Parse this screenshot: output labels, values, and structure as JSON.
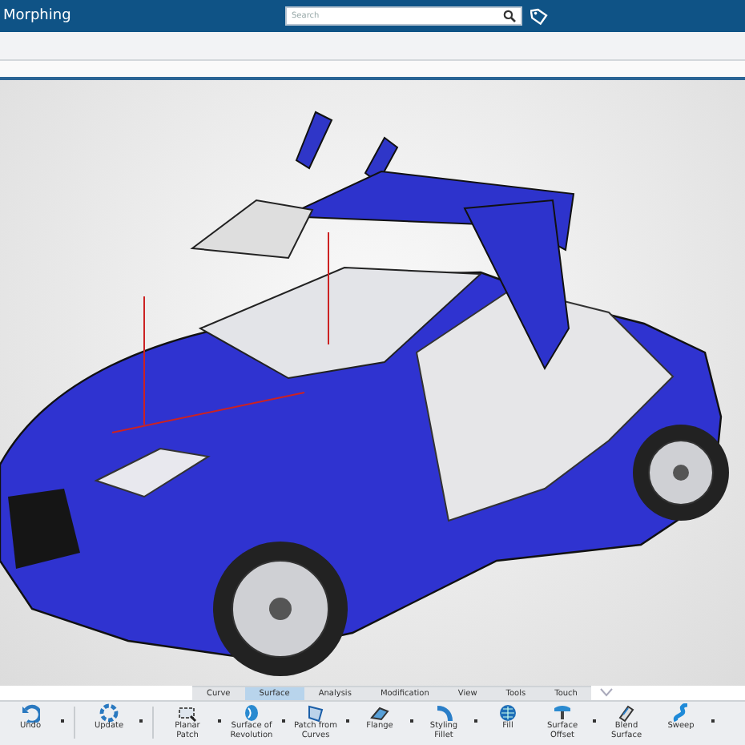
{
  "header": {
    "title": "Morphing",
    "search": {
      "placeholder": "Search"
    }
  },
  "tabs": [
    {
      "label": "Curve",
      "selected": false
    },
    {
      "label": "Surface",
      "selected": true
    },
    {
      "label": "Analysis",
      "selected": false
    },
    {
      "label": "Modification",
      "selected": false
    },
    {
      "label": "View",
      "selected": false
    },
    {
      "label": "Tools",
      "selected": false
    },
    {
      "label": "Touch",
      "selected": false
    }
  ],
  "toolbar": [
    {
      "label": "Undo",
      "dropdown": true,
      "group_end": true
    },
    {
      "label": "Update",
      "dropdown": true,
      "group_end": true
    },
    {
      "label": "Planar Patch",
      "dropdown": true,
      "group_end": false
    },
    {
      "label": "Surface of Revolution",
      "dropdown": true,
      "group_end": false
    },
    {
      "label": "Patch from Curves",
      "dropdown": true,
      "group_end": false
    },
    {
      "label": "Flange",
      "dropdown": true,
      "group_end": false
    },
    {
      "label": "Styling Fillet",
      "dropdown": true,
      "group_end": false
    },
    {
      "label": "Fill",
      "dropdown": false,
      "group_end": false
    },
    {
      "label": "Surface Offset",
      "dropdown": true,
      "group_end": false
    },
    {
      "label": "Blend Surface",
      "dropdown": false,
      "group_end": false
    },
    {
      "label": "Sweep",
      "dropdown": true,
      "group_end": false
    }
  ]
}
